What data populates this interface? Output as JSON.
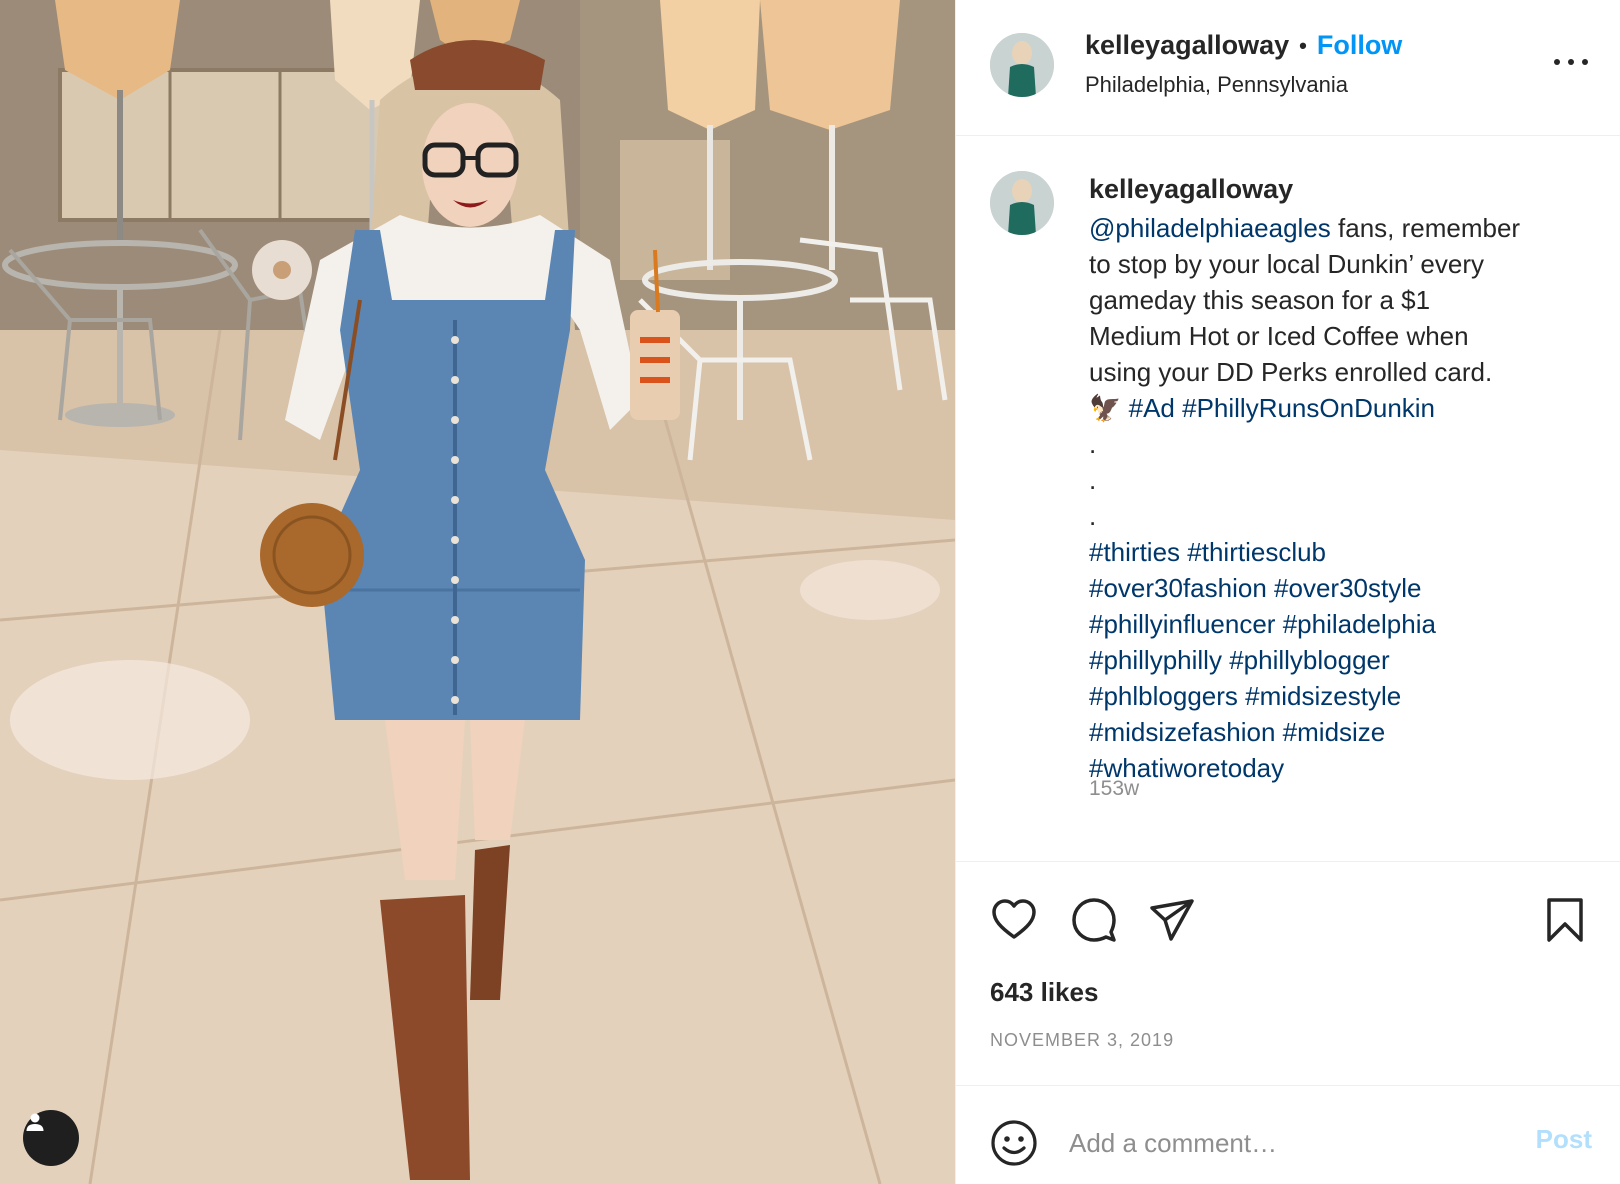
{
  "header": {
    "username": "kelleyagalloway",
    "separator": "•",
    "follow_label": "Follow",
    "location": "Philadelphia, Pennsylvania"
  },
  "caption": {
    "username": "kelleyagalloway",
    "line1_mention": "@philadelphiaeagles",
    "line1_rest": " fans, remember",
    "line2": "to stop by your local Dunkin’ every",
    "line3": "gameday this season for a $1",
    "line4": "Medium Hot or Iced Coffee when",
    "line5": "using your DD Perks enrolled card.",
    "emoji": "🦅",
    "tag_ad": "#Ad",
    "tag_philly": "#PhillyRunsOnDunkin",
    "dots": [
      ".",
      ".",
      "."
    ],
    "hashtag_lines": [
      [
        "#thirties",
        "#thirtiesclub"
      ],
      [
        "#over30fashion",
        "#over30style"
      ],
      [
        "#phillyinfluencer",
        "#philadelphia"
      ],
      [
        "#phillyphilly",
        "#phillyblogger"
      ],
      [
        "#phlbloggers",
        "#midsizestyle"
      ],
      [
        "#midsizefashion",
        "#midsize"
      ],
      [
        "#whatiworetoday"
      ]
    ],
    "time_ago": "153w"
  },
  "actions": {
    "likes_text": "643 likes",
    "date": "NOVEMBER 3, 2019"
  },
  "comment": {
    "placeholder": "Add a comment…",
    "post_label": "Post"
  },
  "colors": {
    "link": "#00376b",
    "follow": "#0095f6",
    "post_disabled": "#b2dffc",
    "muted": "#8e8e8e"
  },
  "icons": [
    "user-tag-icon",
    "more-icon",
    "heart-icon",
    "comment-icon",
    "share-icon",
    "bookmark-icon",
    "emoji-icon"
  ]
}
